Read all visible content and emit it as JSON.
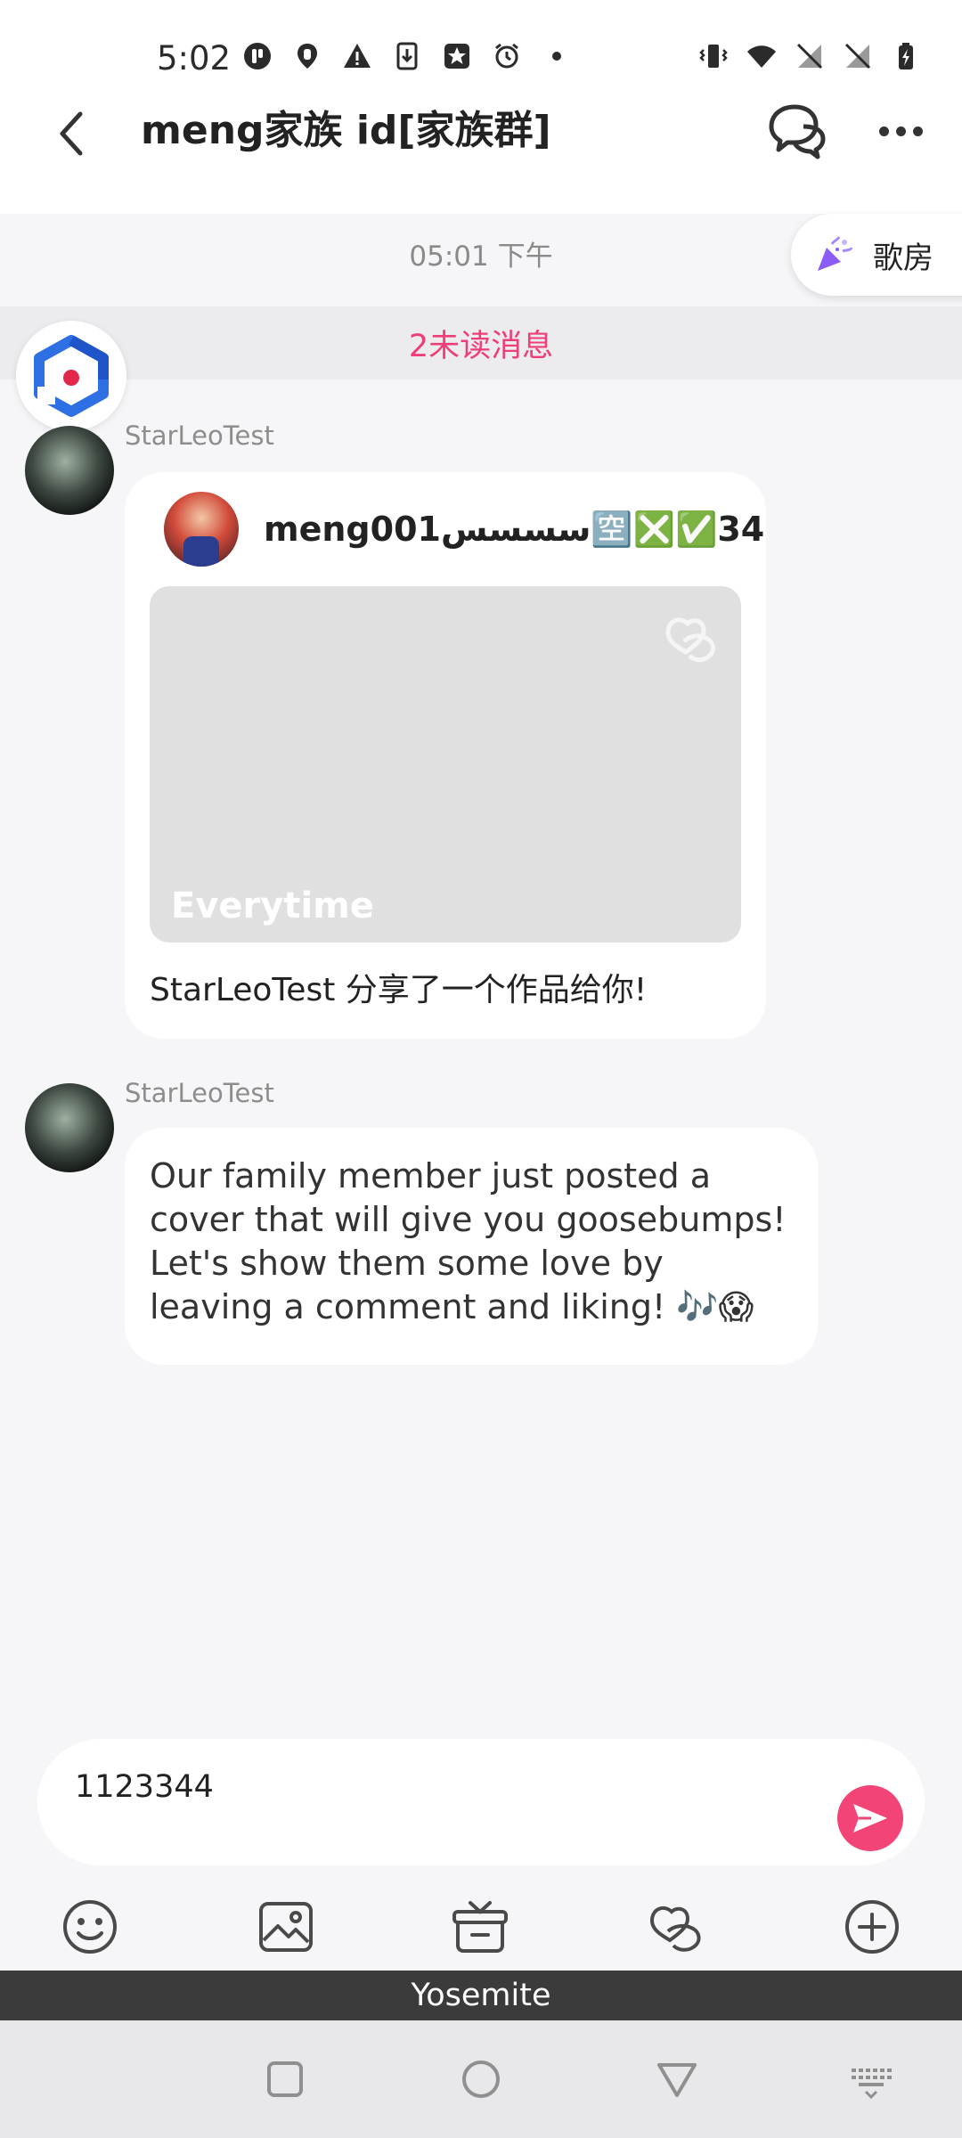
{
  "status_bar": {
    "time": "5:02",
    "icons_left": [
      "app-icon",
      "location-icon",
      "warning-icon",
      "download-icon",
      "star-icon",
      "alarm-icon",
      "dot-icon"
    ],
    "icons_right": [
      "vibrate-icon",
      "wifi-icon",
      "no-signal-icon",
      "no-signal-icon",
      "battery-charging-icon"
    ]
  },
  "header": {
    "title": "meng家族 id[家族群]",
    "back_icon": "chevron-left-icon",
    "chat_icon": "chat-bubbles-icon",
    "more_icon": "more-dots-icon"
  },
  "chat": {
    "time_separator": "05:01 下午",
    "karaoke_chip": {
      "icon": "party-popper-icon",
      "label": "歌房"
    },
    "unread_banner": "2未读消息",
    "messages": [
      {
        "sender": "StarLeoTest",
        "type": "work_card",
        "card_author": "meng001سسسس🈳❎✅34",
        "cover_title": "Everytime",
        "caption": "StarLeoTest 分享了一个作品给你!"
      },
      {
        "sender": "StarLeoTest",
        "type": "text",
        "text": "Our family member just posted a cover that will give you goosebumps! Let's show them some love by leaving a comment and liking! 🎶😱"
      }
    ]
  },
  "composer": {
    "value": "1123344",
    "send_icon": "send-icon"
  },
  "toolbar": [
    "emoji-icon",
    "image-icon",
    "gift-icon",
    "duet-icon",
    "add-icon"
  ],
  "banner": "Yosemite",
  "nav": [
    "recents-icon",
    "home-icon",
    "back-icon",
    "keyboard-icon"
  ],
  "colors": {
    "accent": "#f24477",
    "unread": "#ef3d78",
    "background": "#f6f6f8"
  }
}
